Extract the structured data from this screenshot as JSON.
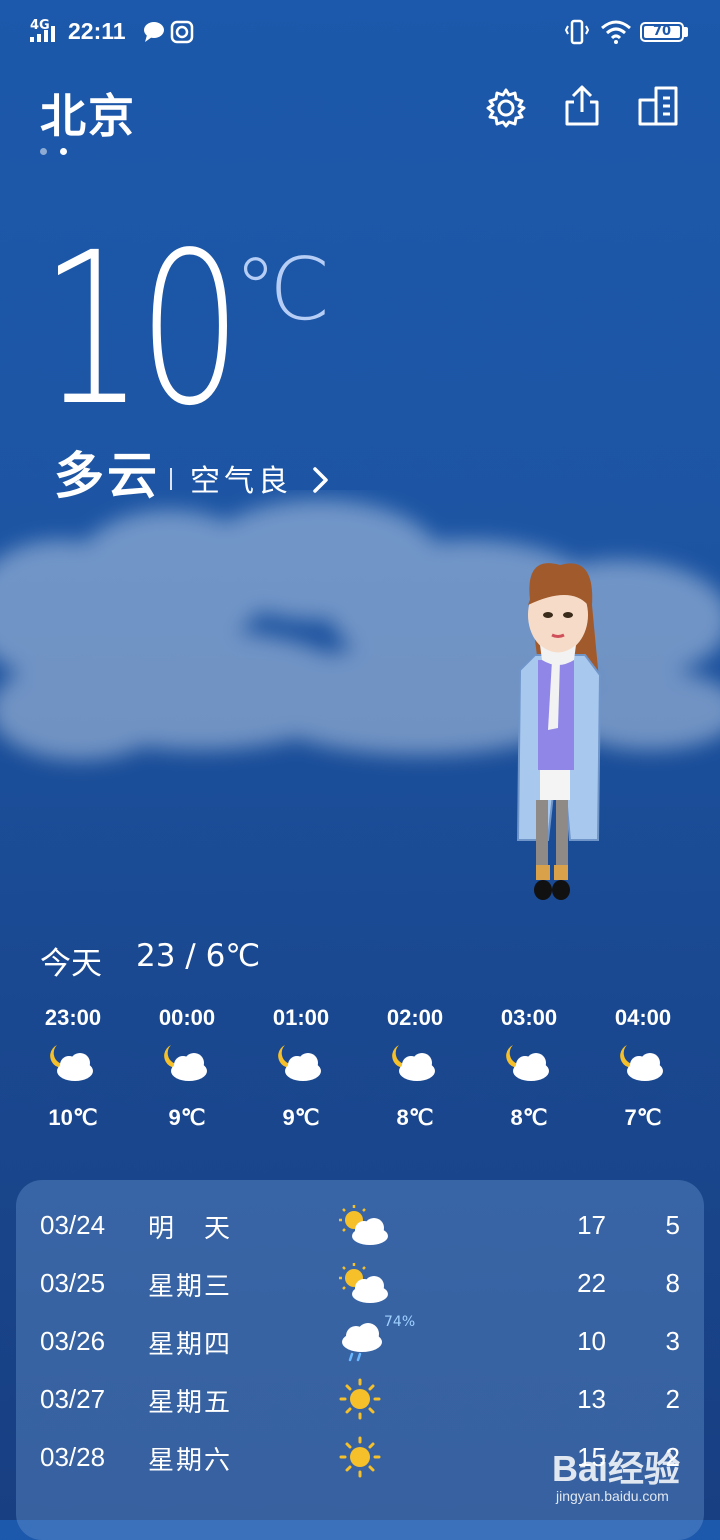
{
  "status_bar": {
    "network": "4G",
    "time": "22:11",
    "battery": "70"
  },
  "header": {
    "city": "北京"
  },
  "current": {
    "temp": "10",
    "unit": "℃",
    "condition": "多云",
    "air_quality": "空气良"
  },
  "today": {
    "label": "今天",
    "range": "23 / 6℃"
  },
  "hourly": [
    {
      "time": "23:00",
      "temp": "10℃",
      "icon": "night-cloudy-icon"
    },
    {
      "time": "00:00",
      "temp": "9℃",
      "icon": "night-cloudy-icon"
    },
    {
      "time": "01:00",
      "temp": "9℃",
      "icon": "night-cloudy-icon"
    },
    {
      "time": "02:00",
      "temp": "8℃",
      "icon": "night-cloudy-icon"
    },
    {
      "time": "03:00",
      "temp": "8℃",
      "icon": "night-cloudy-icon"
    },
    {
      "time": "04:00",
      "temp": "7℃",
      "icon": "night-cloudy-icon"
    }
  ],
  "daily": [
    {
      "date": "03/24",
      "day": "明　天",
      "icon": "partly-cloudy-icon",
      "high": "17",
      "low": "5"
    },
    {
      "date": "03/25",
      "day": "星期三",
      "icon": "partly-cloudy-icon",
      "high": "22",
      "low": "8"
    },
    {
      "date": "03/26",
      "day": "星期四",
      "icon": "rain-icon",
      "precip": "74%",
      "high": "10",
      "low": "3"
    },
    {
      "date": "03/27",
      "day": "星期五",
      "icon": "sunny-icon",
      "high": "13",
      "low": "2"
    },
    {
      "date": "03/28",
      "day": "星期六",
      "icon": "sunny-icon",
      "high": "15",
      "low": "2"
    }
  ],
  "watermark": {
    "brand": "Bai经验",
    "url": "jingyan.baidu.com"
  },
  "colors": {
    "background": "#1c58ab",
    "sun": "#f5c02a",
    "accent_temp_unit": "#b6cef5"
  }
}
